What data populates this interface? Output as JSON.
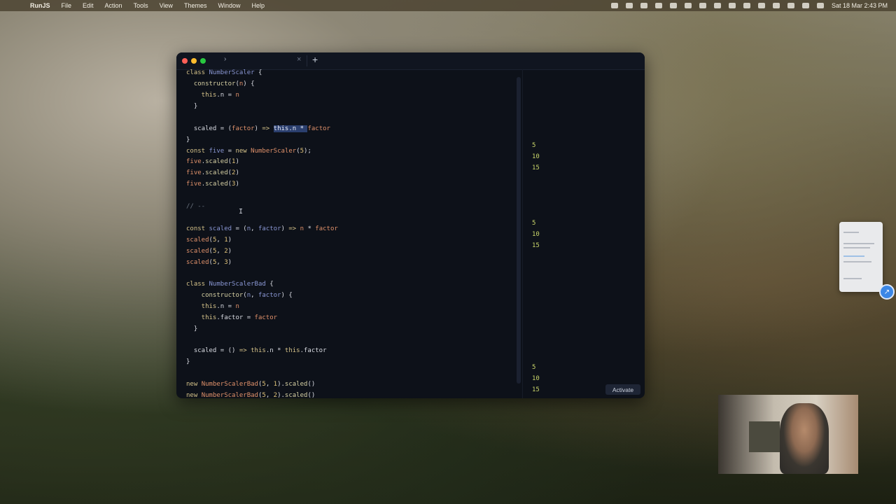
{
  "menubar": {
    "app_name": "RunJS",
    "menus": [
      "File",
      "Edit",
      "Action",
      "Tools",
      "View",
      "Themes",
      "Window",
      "Help"
    ],
    "clock": "Sat 18 Mar  2:43 PM"
  },
  "window": {
    "tab_chevron": "›",
    "tab_close": "×",
    "tab_add": "+",
    "activate_label": "Activate"
  },
  "editor": {
    "lines": [
      "class NumberScaler {",
      "  constructor(n) {",
      "    this.n = n",
      "  }",
      "",
      "  scaled = (factor) => this.n * factor",
      "}",
      "const five = new NumberScaler(5);",
      "five.scaled(1)",
      "five.scaled(2)",
      "five.scaled(3)",
      "",
      "// --",
      "",
      "const scaled = (n, factor) => n * factor",
      "scaled(5, 1)",
      "scaled(5, 2)",
      "scaled(5, 3)",
      "",
      "class NumberScalerBad {",
      "    constructor(n, factor) {",
      "    this.n = n",
      "    this.factor = factor",
      "  }",
      "",
      "  scaled = () => this.n * this.factor",
      "}",
      "",
      "new NumberScalerBad(5, 1).scaled()",
      "new NumberScalerBad(5, 2).scaled()"
    ],
    "selection": "this.n * "
  },
  "output": {
    "results": [
      "5",
      "10",
      "15",
      "5",
      "10",
      "15",
      "5",
      "10",
      "15"
    ]
  }
}
